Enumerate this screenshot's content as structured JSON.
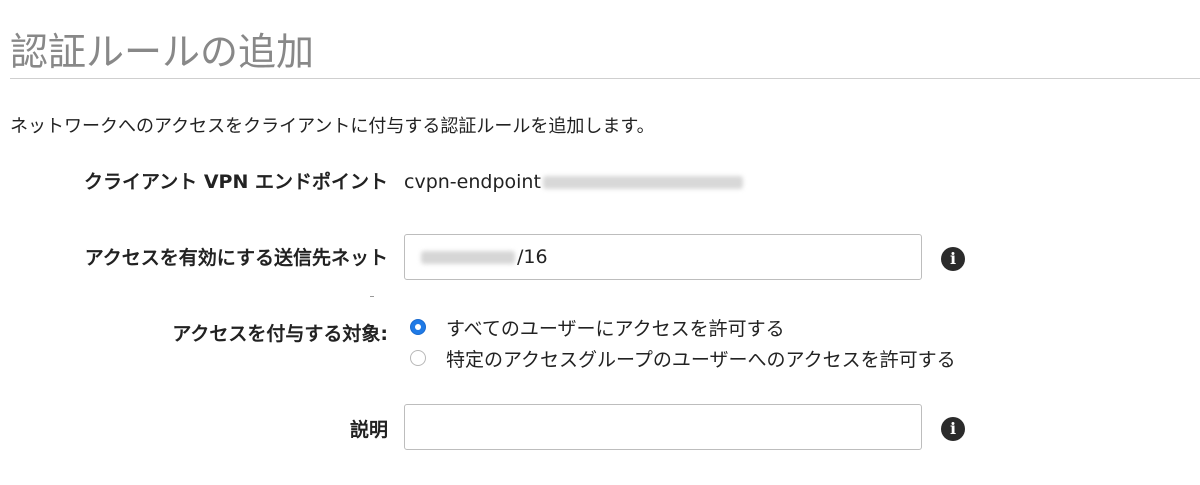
{
  "page": {
    "title": "認証ルールの追加",
    "description": "ネットワークへのアクセスをクライアントに付与する認証ルールを追加します。"
  },
  "form": {
    "endpoint": {
      "label": "クライアント VPN エンドポイント",
      "value_visible": "cvpn-endpoint"
    },
    "destination": {
      "label": "アクセスを有効にする送信先ネット",
      "value_visible_suffix": "/16"
    },
    "grant_access": {
      "label": "アクセスを付与する対象:",
      "options": [
        {
          "label": "すべてのユーザーにアクセスを許可する",
          "selected": true
        },
        {
          "label": "特定のアクセスグループのユーザーへのアクセスを許可する",
          "selected": false
        }
      ]
    },
    "description_field": {
      "label": "説明",
      "value": ""
    }
  },
  "icons": {
    "info": "info-icon",
    "info_glyph": "i"
  },
  "colors": {
    "title_gray": "#888888",
    "radio_selected": "#1f7ae6"
  }
}
